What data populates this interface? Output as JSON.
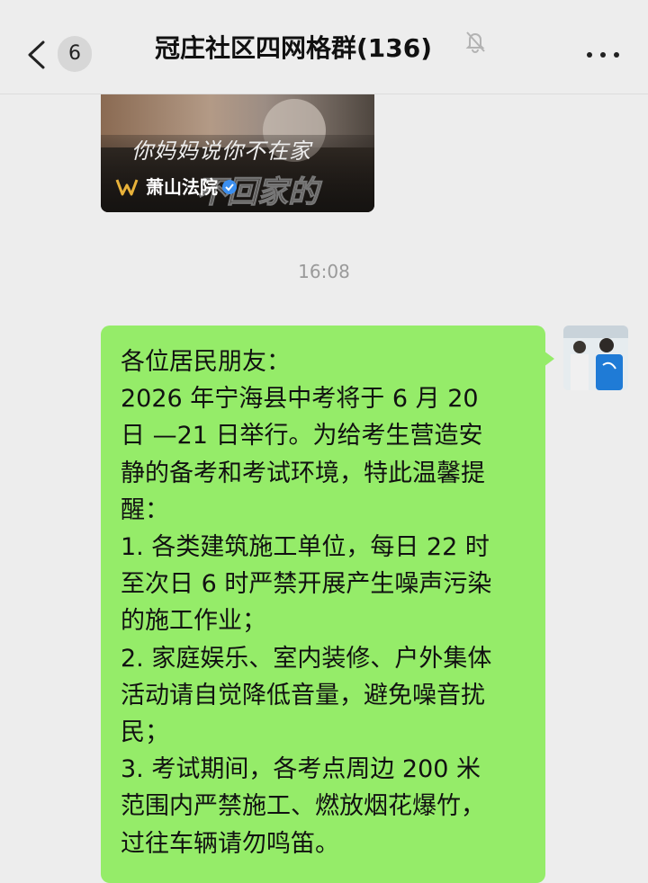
{
  "header": {
    "back_count": "6",
    "title": "冠庄社区四网格群(136)",
    "icons": {
      "back": "chevron-left-icon",
      "mute": "bell-off-icon",
      "more": "more-horizontal-icon"
    }
  },
  "video_card": {
    "subtitle_line1": "你妈妈说你不在家",
    "subtitle_line2": "不回家的",
    "source_name": "萧山法院"
  },
  "timestamp": "16:08",
  "message": {
    "lines": [
      "各位居民朋友：",
      "2026 年宁海县中考将于 6 月 20",
      "日 —21 日举行。为给考生营造安",
      "静的备考和考试环境，特此温馨提",
      "醒：",
      "1. 各类建筑施工单位，每日 22 时",
      "至次日 6 时严禁开展产生噪声污染",
      "的施工作业；",
      "2. 家庭娱乐、室内装修、户外集体",
      "活动请自觉降低音量，避免噪音扰",
      "民；",
      "3. 考试期间，各考点周边 200 米",
      "范围内严禁施工、燃放烟花爆竹，",
      "过往车辆请勿鸣笛。"
    ],
    "bubble_color": "#95ec69"
  },
  "colors": {
    "background": "#ededed",
    "timestamp": "#9a9a9a"
  }
}
